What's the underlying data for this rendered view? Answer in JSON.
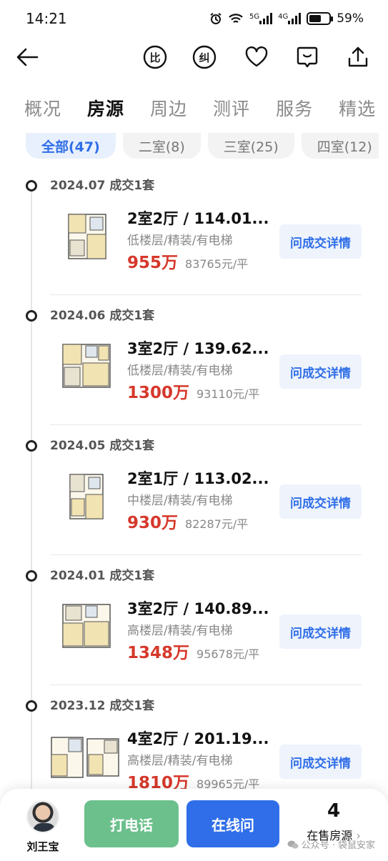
{
  "status_bar": {
    "time": "14:21",
    "network_5g": "5G",
    "network_4g": "4G",
    "battery_percent": "59%"
  },
  "top_nav": {
    "back_icon": "arrow-left-icon",
    "compare_label": "比",
    "correct_label": "纠",
    "favorite_icon": "heart-icon",
    "message_icon": "chat-icon",
    "share_icon": "share-icon"
  },
  "tabs": [
    {
      "label": "概况",
      "active": false
    },
    {
      "label": "房源",
      "active": true
    },
    {
      "label": "周边",
      "active": false
    },
    {
      "label": "测评",
      "active": false
    },
    {
      "label": "服务",
      "active": false
    },
    {
      "label": "精选",
      "active": false
    }
  ],
  "filters": [
    {
      "label": "全部(47)",
      "active": true
    },
    {
      "label": "二室(8)",
      "active": false
    },
    {
      "label": "三室(25)",
      "active": false
    },
    {
      "label": "四室(12)",
      "active": false
    }
  ],
  "transactions": [
    {
      "date": "2024.07 成交1套",
      "title": "2室2厅 / 114.01...",
      "subtitle": "低楼层/精装/有电梯",
      "price": "955万",
      "unit_price": "83765元/平",
      "button": "问成交详情"
    },
    {
      "date": "2024.06 成交1套",
      "title": "3室2厅 / 139.62...",
      "subtitle": "低楼层/精装/有电梯",
      "price": "1300万",
      "unit_price": "93110元/平",
      "button": "问成交详情"
    },
    {
      "date": "2024.05 成交1套",
      "title": "2室1厅 / 113.02...",
      "subtitle": "中楼层/精装/有电梯",
      "price": "930万",
      "unit_price": "82287元/平",
      "button": "问成交详情"
    },
    {
      "date": "2024.01 成交1套",
      "title": "3室2厅 / 140.89...",
      "subtitle": "高楼层/精装/有电梯",
      "price": "1348万",
      "unit_price": "95678元/平",
      "button": "问成交详情"
    },
    {
      "date": "2023.12 成交1套",
      "title": "4室2厅 / 201.19...",
      "subtitle": "高楼层/精装/有电梯",
      "price": "1810万",
      "unit_price": "89965元/平",
      "button": "问成交详情"
    }
  ],
  "bottom_bar": {
    "agent_name": "刘王宝",
    "call_label": "打电话",
    "chat_label": "在线问",
    "onsale_count": "4",
    "onsale_label": "在售房源",
    "watermark": "公众号 · 袋鼠安家"
  },
  "colors": {
    "accent_blue": "#2f6ee8",
    "price_red": "#d6382b",
    "call_green": "#6cc08c"
  }
}
